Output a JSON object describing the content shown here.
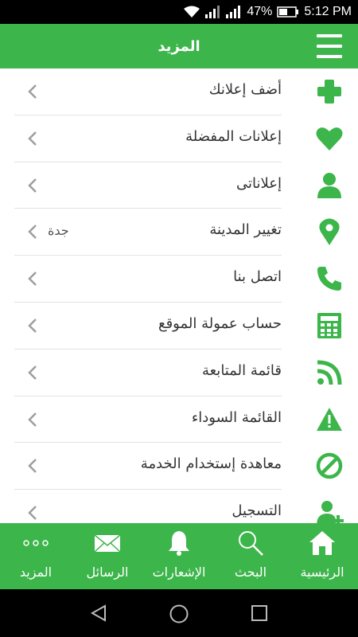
{
  "status_bar": {
    "battery_percent": "47%",
    "time": "5:12 PM"
  },
  "app_bar": {
    "title": "المزيد",
    "menu_icon": "hamburger-menu-icon"
  },
  "colors": {
    "primary": "#3cb54a",
    "text": "#333333",
    "chevron": "#9e9e9e"
  },
  "menu": {
    "items": [
      {
        "label": "أضف إعلانك",
        "value": "",
        "icon": "plus-icon"
      },
      {
        "label": "إعلانات المفضلة",
        "value": "",
        "icon": "heart-icon"
      },
      {
        "label": "إعلاناتى",
        "value": "",
        "icon": "user-icon"
      },
      {
        "label": "تغيير المدينة",
        "value": "جدة",
        "icon": "location-pin-icon"
      },
      {
        "label": "اتصل بنا",
        "value": "",
        "icon": "phone-icon"
      },
      {
        "label": "حساب عمولة الموقع",
        "value": "",
        "icon": "calculator-icon"
      },
      {
        "label": "قائمة المتابعة",
        "value": "",
        "icon": "rss-icon"
      },
      {
        "label": "القائمة السوداء",
        "value": "",
        "icon": "warning-icon"
      },
      {
        "label": "معاهدة إستخدام الخدمة",
        "value": "",
        "icon": "ban-icon"
      },
      {
        "label": "التسجيل",
        "value": "",
        "icon": "add-user-icon"
      }
    ]
  },
  "bottom_nav": {
    "items": [
      {
        "label": "المزيد",
        "icon": "more-dots-icon"
      },
      {
        "label": "الرسائل",
        "icon": "envelope-icon"
      },
      {
        "label": "الإشعارات",
        "icon": "bell-icon"
      },
      {
        "label": "البحث",
        "icon": "search-icon"
      },
      {
        "label": "الرئيسية",
        "icon": "home-icon"
      }
    ]
  }
}
